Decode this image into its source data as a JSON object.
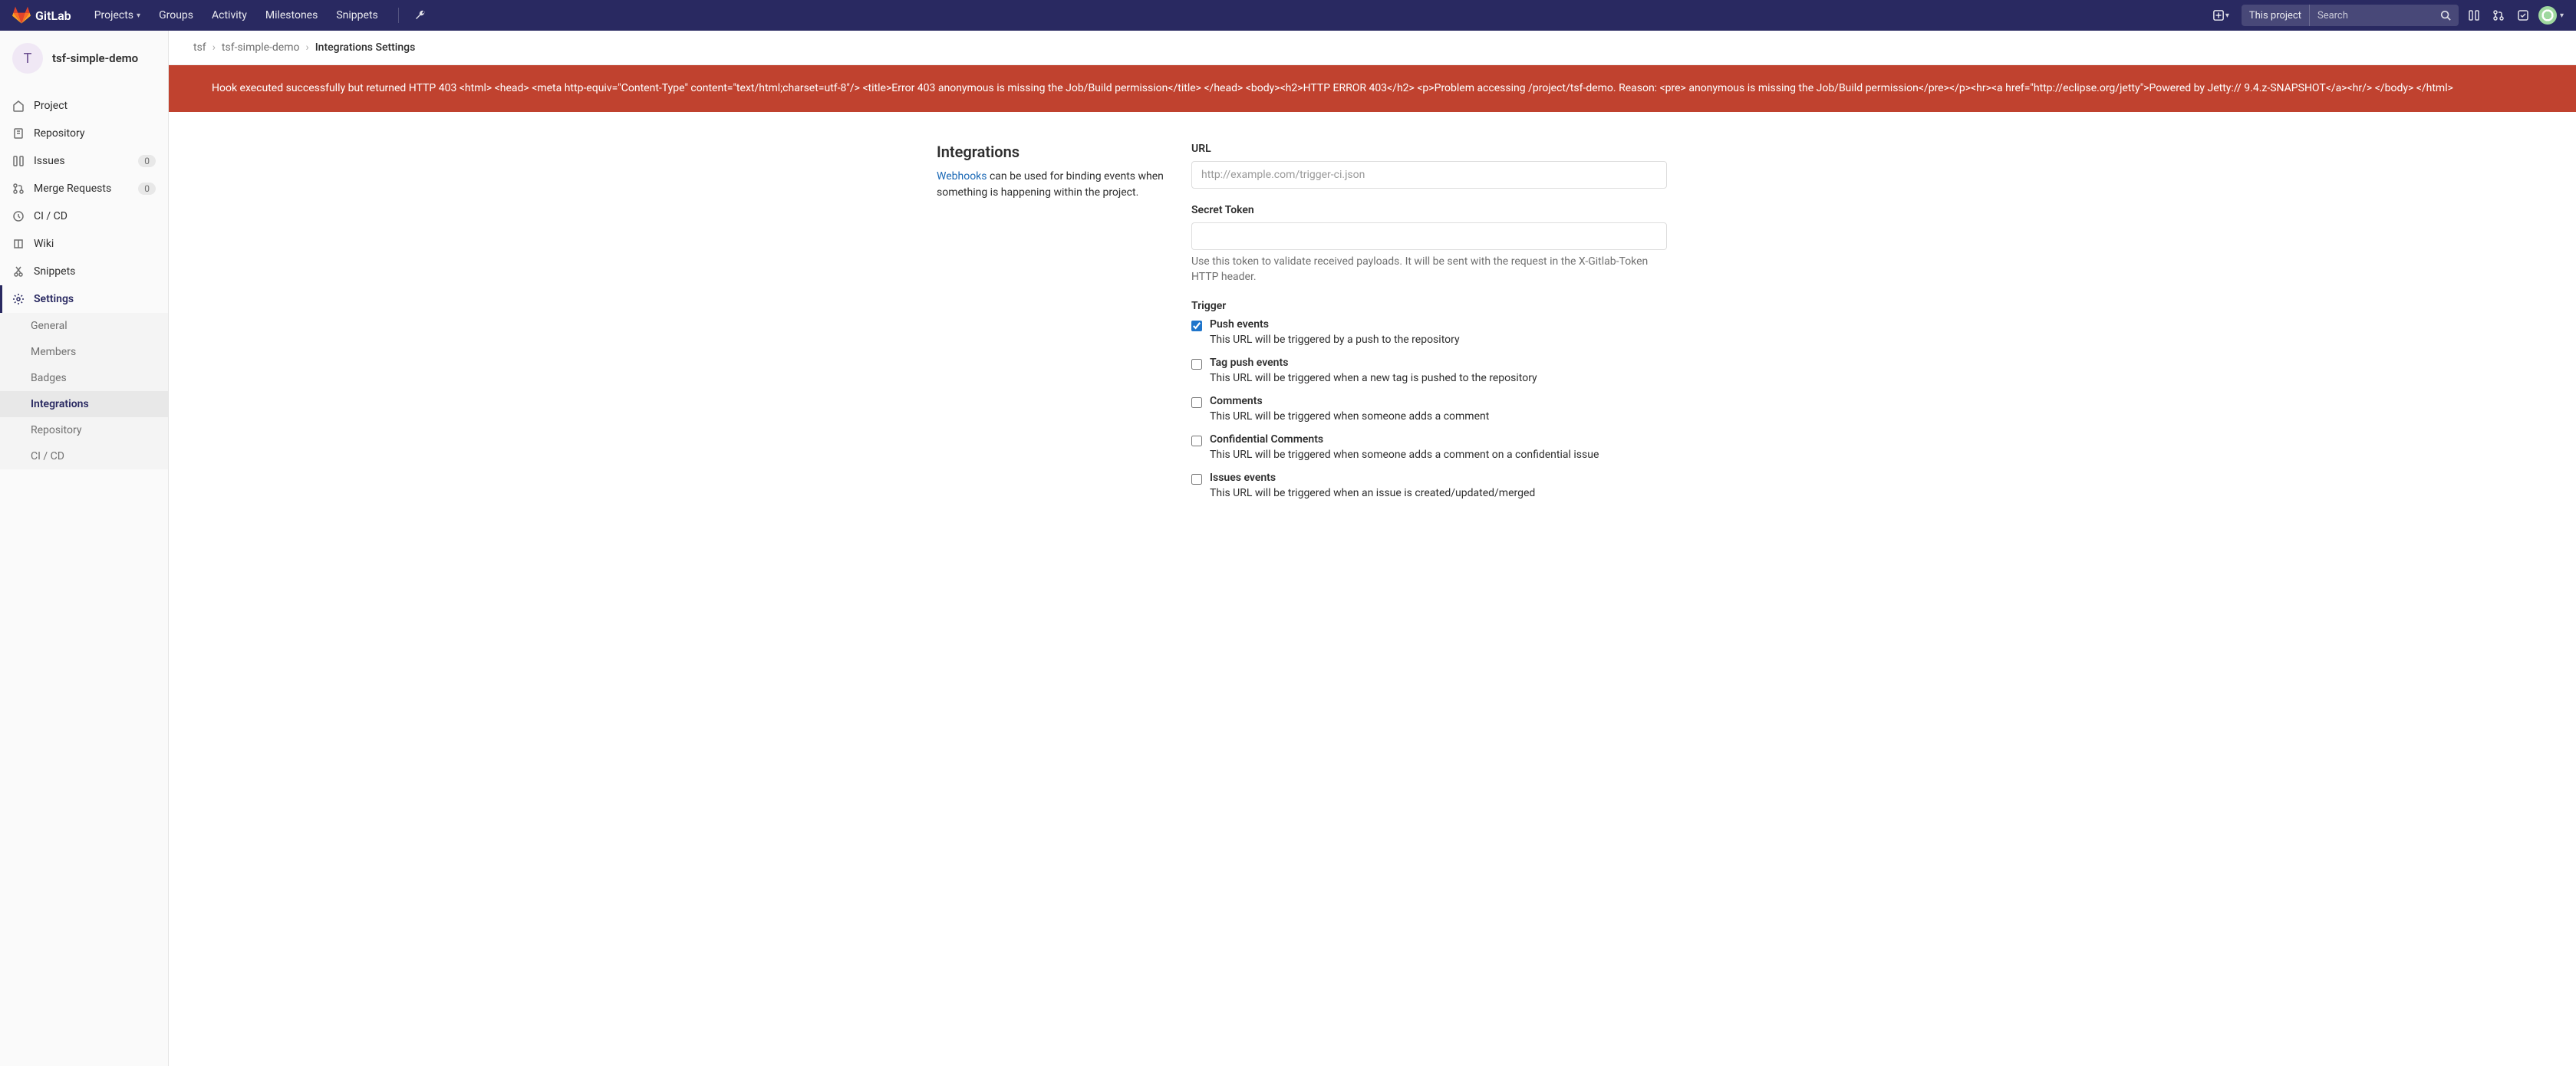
{
  "topnav": {
    "brand": "GitLab",
    "items": [
      "Projects",
      "Groups",
      "Activity",
      "Milestones",
      "Snippets"
    ],
    "search_scope": "This project",
    "search_placeholder": "Search"
  },
  "project": {
    "initial": "T",
    "name": "tsf-simple-demo"
  },
  "sidebar": {
    "items": [
      {
        "icon": "home-icon",
        "label": "Project"
      },
      {
        "icon": "repo-icon",
        "label": "Repository"
      },
      {
        "icon": "issues-icon",
        "label": "Issues",
        "badge": "0"
      },
      {
        "icon": "merge-icon",
        "label": "Merge Requests",
        "badge": "0"
      },
      {
        "icon": "cicd-icon",
        "label": "CI / CD"
      },
      {
        "icon": "wiki-icon",
        "label": "Wiki"
      },
      {
        "icon": "snippets-icon",
        "label": "Snippets"
      },
      {
        "icon": "settings-icon",
        "label": "Settings",
        "active": true
      }
    ],
    "sub_items": [
      "General",
      "Members",
      "Badges",
      "Integrations",
      "Repository",
      "CI / CD"
    ],
    "sub_active": "Integrations"
  },
  "breadcrumb": {
    "parts": [
      "tsf",
      "tsf-simple-demo"
    ],
    "current": "Integrations Settings"
  },
  "alert": "Hook executed successfully but returned HTTP 403 <html> <head> <meta http-equiv=\"Content-Type\" content=\"text/html;charset=utf-8\"/> <title>Error 403 anonymous is missing the Job/Build permission</title> </head> <body><h2>HTTP ERROR 403</h2> <p>Problem accessing /project/tsf-demo. Reason: <pre> anonymous is missing the Job/Build permission</pre></p><hr><a href=\"http://eclipse.org/jetty\">Powered by Jetty:// 9.4.z-SNAPSHOT</a><hr/> </body> </html>",
  "integrations": {
    "title": "Integrations",
    "link_text": "Webhooks",
    "desc_rest": " can be used for binding events when something is happening within the project."
  },
  "form": {
    "url_label": "URL",
    "url_placeholder": "http://example.com/trigger-ci.json",
    "token_label": "Secret Token",
    "token_help": "Use this token to validate received payloads. It will be sent with the request in the X-Gitlab-Token HTTP header.",
    "trigger_label": "Trigger",
    "triggers": [
      {
        "label": "Push events",
        "desc": "This URL will be triggered by a push to the repository",
        "checked": true
      },
      {
        "label": "Tag push events",
        "desc": "This URL will be triggered when a new tag is pushed to the repository",
        "checked": false
      },
      {
        "label": "Comments",
        "desc": "This URL will be triggered when someone adds a comment",
        "checked": false
      },
      {
        "label": "Confidential Comments",
        "desc": "This URL will be triggered when someone adds a comment on a confidential issue",
        "checked": false
      },
      {
        "label": "Issues events",
        "desc": "This URL will be triggered when an issue is created/updated/merged",
        "checked": false
      }
    ]
  }
}
